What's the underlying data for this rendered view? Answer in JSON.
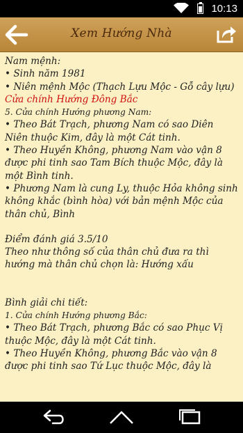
{
  "status_bar": {
    "time": "10:13",
    "icons": [
      "wifi-icon",
      "battery-charging-icon"
    ]
  },
  "app_bar": {
    "title": "Xem Hướng Nhà",
    "back_icon": "arrow-left-icon",
    "share_icon": "share-icon",
    "background": "#c49548"
  },
  "content": {
    "background": "#fbf1c4",
    "menh_heading": "Nam mệnh:",
    "birth_year": "• Sinh năm 1981",
    "nien_menh": "• Niên mệnh Mộc (Thạch Lựu Mộc - Gỗ cây lựu)",
    "main_door": "Cửa chính Hướng Đông Bắc",
    "item5_title": "5. Cửa chính Hướng phương Nam:",
    "item5_bat_trach": "• Theo Bát Trạch, phương Nam có sao Diên Niên thuộc Kim, đây là một Cát tinh.",
    "item5_huyen_khong": "• Theo Huyền Không, phương Nam vào vận 8 được phi tinh sao Tam Bích thuộc Mộc, đây là một Bình tinh.",
    "item5_ly": "• Phương Nam là cung Ly, thuộc Hỏa không sinh không khắc (bình hòa) với bản mệnh Mộc của thân chủ, Bình",
    "score": "Điểm đánh giá 3.5/10",
    "score_note": "Theo như thông số của thân chủ đưa ra thì hướng mà thân chủ chọn là: Hướng xấu",
    "detail_heading": "Bình giải chi tiết:",
    "item1_title": "1. Cửa chính Hướng phương Bắc:",
    "item1_bat_trach": "• Theo Bát Trạch, phương Bắc có sao Phục Vị thuộc Mộc, đây là một Cát tinh.",
    "item1_huyen_khong": "• Theo Huyền Không, phương Bắc vào vận 8 được phi tinh sao Tứ Lục thuộc Mộc, đây là"
  },
  "nav_bar": {
    "icons": [
      "back-nav-icon",
      "home-nav-icon",
      "recent-apps-icon"
    ]
  }
}
